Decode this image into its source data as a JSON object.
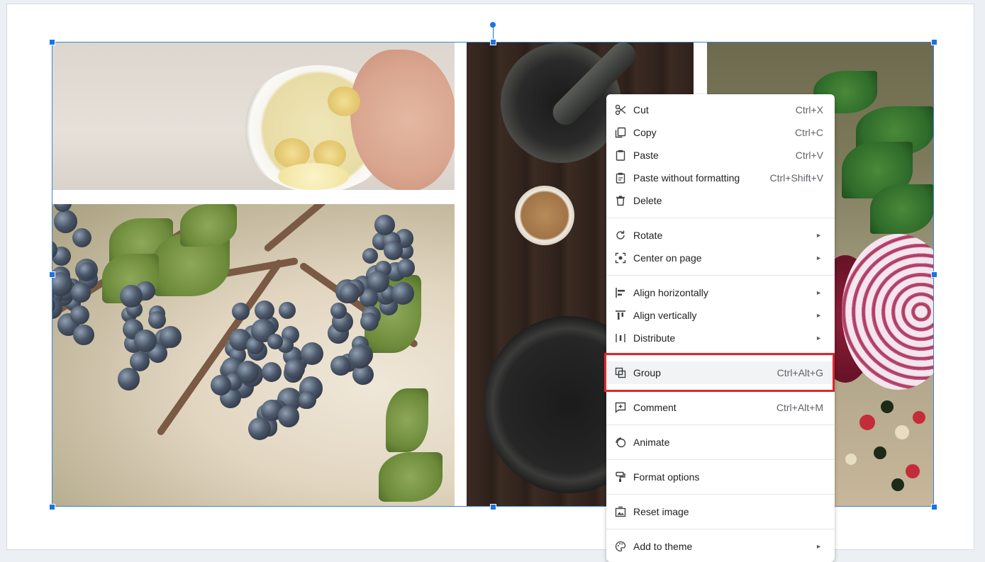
{
  "menu": {
    "items": [
      {
        "label": "Cut",
        "shortcut": "Ctrl+X",
        "icon": "scissors-icon"
      },
      {
        "label": "Copy",
        "shortcut": "Ctrl+C",
        "icon": "copy-icon"
      },
      {
        "label": "Paste",
        "shortcut": "Ctrl+V",
        "icon": "clipboard-icon"
      },
      {
        "label": "Paste without formatting",
        "shortcut": "Ctrl+Shift+V",
        "icon": "paste-plain-icon"
      },
      {
        "label": "Delete",
        "shortcut": "",
        "icon": "trash-icon"
      },
      {
        "label": "Rotate",
        "shortcut": "",
        "icon": "rotate-icon"
      },
      {
        "label": "Center on page",
        "shortcut": "",
        "icon": "center-icon"
      },
      {
        "label": "Align horizontally",
        "shortcut": "",
        "icon": "align-horizontal-icon"
      },
      {
        "label": "Align vertically",
        "shortcut": "",
        "icon": "align-vertical-icon"
      },
      {
        "label": "Distribute",
        "shortcut": "",
        "icon": "distribute-icon"
      },
      {
        "label": "Group",
        "shortcut": "Ctrl+Alt+G",
        "icon": "group-icon"
      },
      {
        "label": "Comment",
        "shortcut": "Ctrl+Alt+M",
        "icon": "comment-add-icon"
      },
      {
        "label": "Animate",
        "shortcut": "",
        "icon": "animate-icon"
      },
      {
        "label": "Format options",
        "shortcut": "",
        "icon": "format-paint-icon"
      },
      {
        "label": "Reset image",
        "shortcut": "",
        "icon": "reset-image-icon"
      },
      {
        "label": "Add to theme",
        "shortcut": "",
        "icon": "palette-icon"
      }
    ],
    "submenu_arrow": "►",
    "highlighted": "Group"
  },
  "colors": {
    "selection": "#1a73e8",
    "highlight_border": "#e0262c"
  }
}
